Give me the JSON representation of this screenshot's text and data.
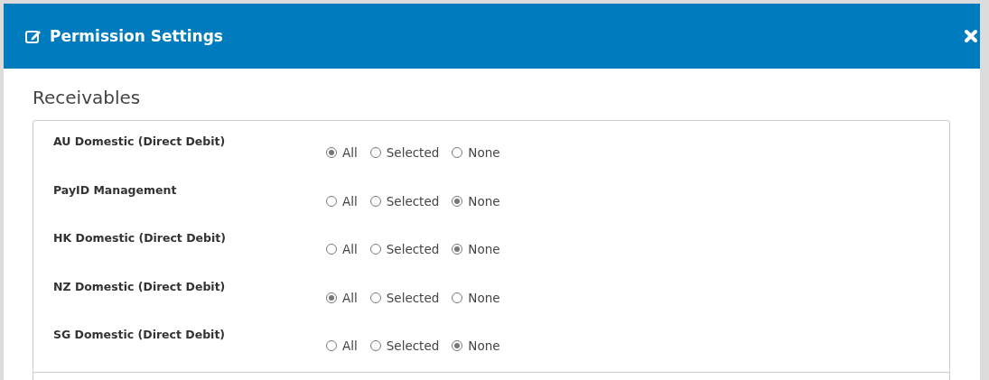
{
  "dialog": {
    "title": "Permission Settings"
  },
  "section": {
    "title": "Receivables"
  },
  "rows": [
    {
      "label": "AU Domestic (Direct Debit)",
      "options": [
        {
          "label": "All",
          "selected": true
        },
        {
          "label": "Selected",
          "selected": false
        },
        {
          "label": "None",
          "selected": false
        }
      ]
    },
    {
      "label": "PayID Management",
      "options": [
        {
          "label": "All",
          "selected": false
        },
        {
          "label": "Selected",
          "selected": false
        },
        {
          "label": "None",
          "selected": true
        }
      ]
    },
    {
      "label": "HK Domestic (Direct Debit)",
      "options": [
        {
          "label": "All",
          "selected": false
        },
        {
          "label": "Selected",
          "selected": false
        },
        {
          "label": "None",
          "selected": true
        }
      ]
    },
    {
      "label": "NZ Domestic (Direct Debit)",
      "options": [
        {
          "label": "All",
          "selected": true
        },
        {
          "label": "Selected",
          "selected": false
        },
        {
          "label": "None",
          "selected": false
        }
      ]
    },
    {
      "label": "SG Domestic (Direct Debit)",
      "options": [
        {
          "label": "All",
          "selected": false
        },
        {
          "label": "Selected",
          "selected": false
        },
        {
          "label": "None",
          "selected": true
        }
      ]
    }
  ]
}
